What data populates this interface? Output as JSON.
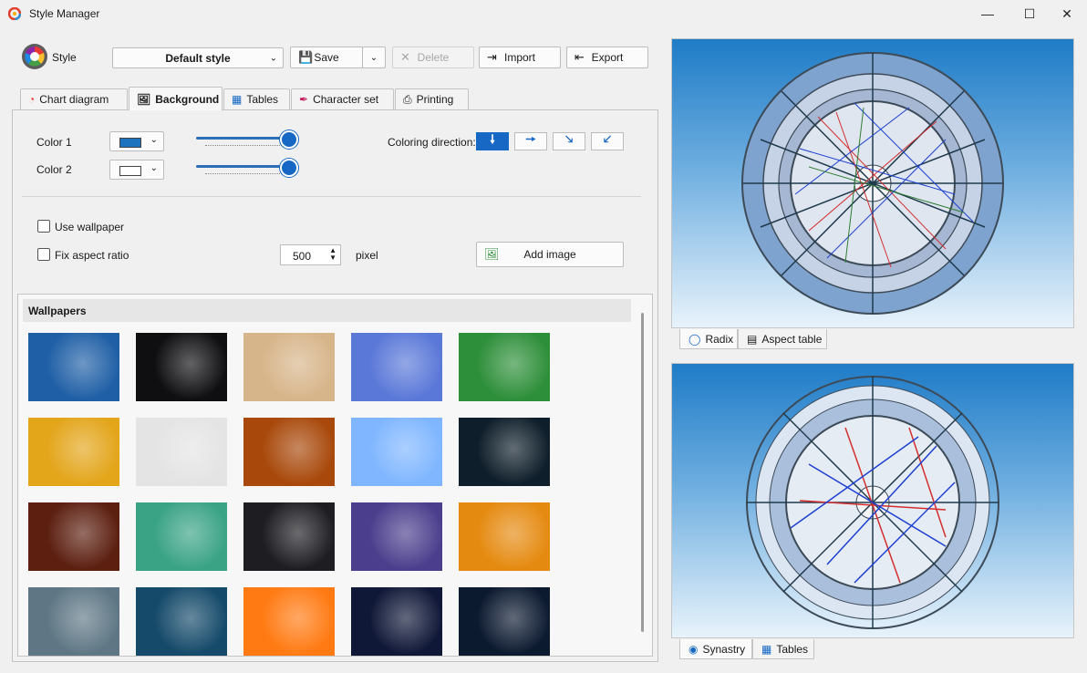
{
  "window": {
    "title": "Style Manager"
  },
  "toolbar": {
    "style_label": "Style",
    "style_value": "Default style",
    "save": "Save",
    "delete": "Delete",
    "import": "Import",
    "export": "Export"
  },
  "tabs": [
    {
      "label": "Chart diagram",
      "icon": "pie-icon"
    },
    {
      "label": "Background",
      "icon": "image-icon",
      "active": true
    },
    {
      "label": "Tables",
      "icon": "table-icon"
    },
    {
      "label": "Character set",
      "icon": "pen-icon"
    },
    {
      "label": "Printing",
      "icon": "printer-icon"
    }
  ],
  "background": {
    "color1_label": "Color 1",
    "color1": "#1e73be",
    "color2_label": "Color 2",
    "color2": "#ffffff",
    "slider1_level": 1.0,
    "slider2_level": 1.0,
    "coloring_direction_label": "Coloring direction:",
    "directions": [
      "down-arrow",
      "right-arrow",
      "down-right-arrow",
      "down-left-arrow"
    ],
    "active_direction": "down-arrow",
    "use_wallpaper": "Use wallpaper",
    "fix_aspect": "Fix aspect ratio",
    "size_value": "500",
    "size_unit": "pixel",
    "add_image": "Add image"
  },
  "wallpapers": {
    "title": "Wallpapers",
    "items": [
      [
        "#1f5fa6",
        "#0f0f12",
        "#d7b58a",
        "#5a78d8",
        "#2e8f3a"
      ],
      [
        "#e3a51a",
        "#e4e4e4",
        "#a8480a",
        "#7fb6ff",
        "#0e1e2a"
      ],
      [
        "#5c1f10",
        "#3aa386",
        "#1d1d22",
        "#4b3f8d",
        "#e58a10"
      ],
      [
        "#5f7785",
        "#154a6a",
        "#ff7a12",
        "#101838",
        "#0c1a30"
      ]
    ]
  },
  "preview": {
    "top_tabs": [
      {
        "label": "Radix",
        "icon": "circle-icon"
      },
      {
        "label": "Aspect table",
        "icon": "stairs-icon"
      }
    ],
    "bottom_tabs": [
      {
        "label": "Synastry",
        "icon": "target-icon"
      },
      {
        "label": "Tables",
        "icon": "table-icon"
      }
    ]
  }
}
